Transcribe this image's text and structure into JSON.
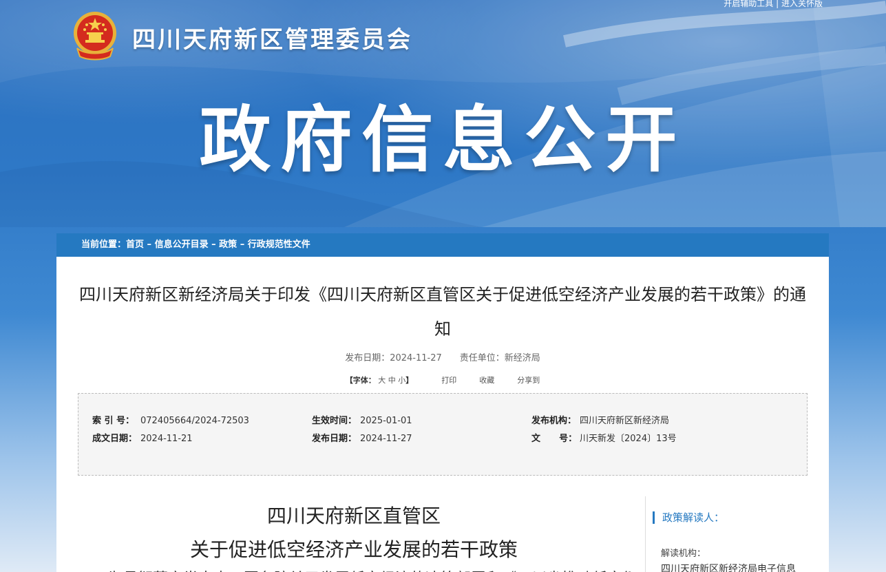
{
  "header": {
    "toplinks": [
      "开启辅助工具",
      "进入关怀版"
    ],
    "site_title": "四川天府新区管理委员会",
    "hero_title": "政府信息公开"
  },
  "breadcrumb": {
    "prefix": "当前位置：",
    "items": [
      "首页",
      "信息公开目录",
      "政策",
      "行政规范性文件"
    ],
    "separator": " – "
  },
  "document": {
    "title": "四川天府新区新经济局关于印发《四川天府新区直管区关于促进低空经济产业发展的若干政策》的通知",
    "publish_date_label": "发布日期：",
    "publish_date": "2024-11-27",
    "dept_label": "责任单位：",
    "dept": "新经济局",
    "font_label": "【字体：",
    "font_sizes": [
      "大",
      "中",
      "小"
    ],
    "font_close": "】",
    "print": "打印",
    "favorite": "收藏",
    "share": "分享到"
  },
  "info": {
    "index_label": "索 引 号：",
    "index_value": "072405664/2024-72503",
    "effective_label": "生效时间：",
    "effective_value": "2025-01-01",
    "org_label": "发布机构：",
    "org_value": "四川天府新区新经济局",
    "created_label": "成文日期：",
    "created_value": "2024-11-21",
    "pub_label": "发布日期：",
    "pub_value": "2024-11-27",
    "docno_label": "文      号：",
    "docno_value": "川天新发〔2024〕13号"
  },
  "content": {
    "title_line1": "四川天府新区直管区",
    "title_line2": "关于促进低空经济产业发展的若干政策",
    "body_first_line": "为贯彻落实党中央、国务院关于发展低空经济的决策部署和《四川省推动低空经济高质量发展"
  },
  "sidebar": {
    "heading": "政策解读人：",
    "org_label": "解读机构：",
    "org_value": "四川天府新区新经济局电子信息"
  }
}
